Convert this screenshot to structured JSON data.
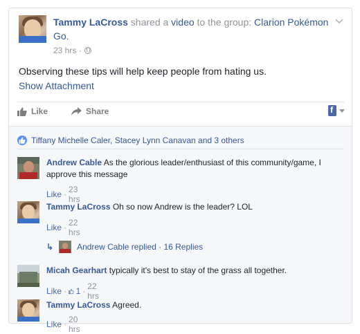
{
  "post": {
    "author": "Tammy LaCross",
    "shared_text": " shared a ",
    "object": "video",
    "to_text": " to the group: ",
    "group": "Clarion Pokémon Go.",
    "time": "23 hrs ·",
    "body": "Observing these tips will help keep people from hating us.",
    "show_attachment": "Show Attachment"
  },
  "actions": {
    "like": "Like",
    "share": "Share"
  },
  "likes_summary": "Tiffany Michelle Caler, Stacey Lynn Canavan and 3 others",
  "comments": [
    {
      "author": "Andrew Cable",
      "text": "As the glorious leader/enthusiast of this community/game, I approve this message",
      "like": "Like",
      "sep": "·",
      "time": "23 hrs"
    },
    {
      "author": "Tammy LaCross",
      "text": "Oh so now Andrew is the leader? LOL",
      "like": "Like",
      "sep": "·",
      "time": "22 hrs"
    },
    {
      "author": "Micah Gearhart",
      "text": "typically it's best to stay of the grass all together.",
      "like": "Like",
      "sep": "·",
      "like_count": "1",
      "sep2": "·",
      "time": "22 hrs"
    },
    {
      "author": "Tammy LaCross",
      "text": "Agreed.",
      "like": "Like",
      "sep": "·",
      "time": "20 hrs"
    }
  ],
  "reply_summary": {
    "author": "Andrew Cable",
    "text": " replied · 16 Replies"
  },
  "icons": [
    "thumbs-up-icon",
    "share-arrow-icon",
    "globe-icon",
    "chevron-down-icon",
    "reply-arrow-icon",
    "facebook-icon"
  ],
  "colors": {
    "link": "#365899",
    "meta": "#90949c",
    "like_badge": "#5890ff"
  }
}
